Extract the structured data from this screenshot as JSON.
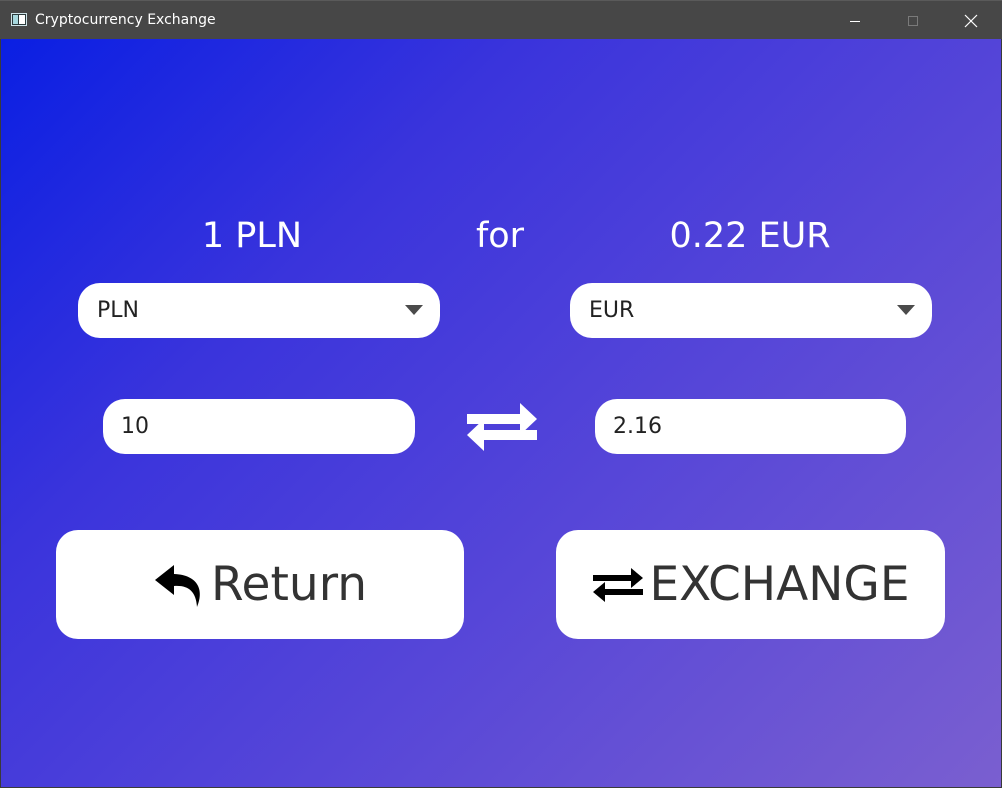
{
  "window": {
    "title": "Cryptocurrency Exchange"
  },
  "rate": {
    "from_text": "1 PLN",
    "joiner": "for",
    "to_text": "0.22 EUR"
  },
  "from_currency": {
    "selected": "PLN",
    "amount": "10"
  },
  "to_currency": {
    "selected": "EUR",
    "amount": "2.16"
  },
  "actions": {
    "return_label": "Return",
    "exchange_label": "EXCHANGE"
  },
  "icons": {
    "app": "app-window-icon",
    "swap": "swap-arrows-icon",
    "return": "return-arrow-icon",
    "exchange": "exchange-arrows-icon"
  }
}
